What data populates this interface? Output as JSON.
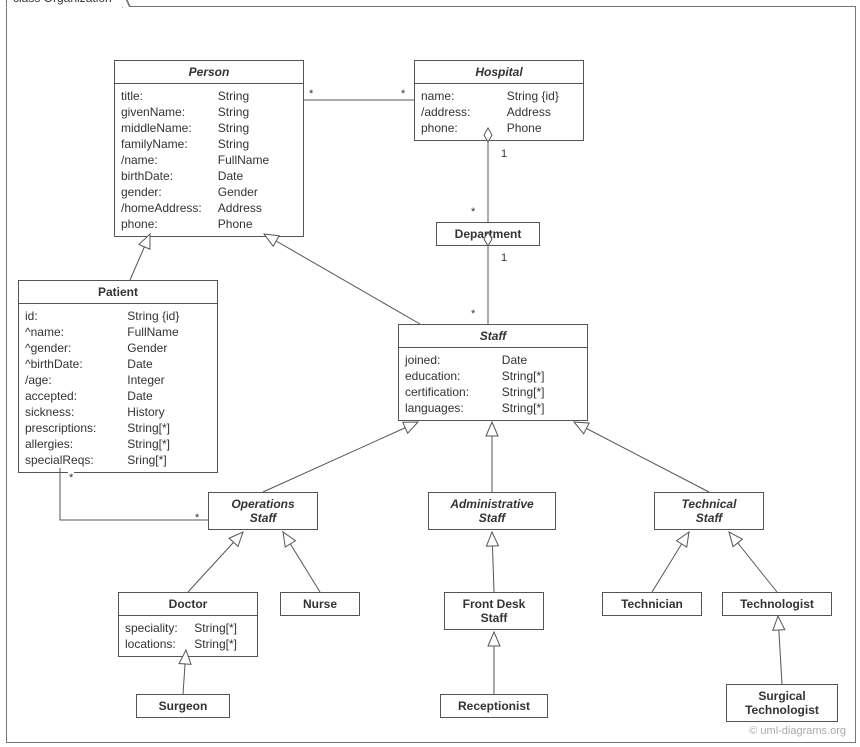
{
  "package_name": "class Organization",
  "watermark": "© uml-diagrams.org",
  "classes": {
    "person": {
      "name": "Person",
      "attrs": [
        {
          "n": "title:",
          "t": "String"
        },
        {
          "n": "givenName:",
          "t": "String"
        },
        {
          "n": "middleName:",
          "t": "String"
        },
        {
          "n": "familyName:",
          "t": "String"
        },
        {
          "n": "/name:",
          "t": "FullName"
        },
        {
          "n": "birthDate:",
          "t": "Date"
        },
        {
          "n": "gender:",
          "t": "Gender"
        },
        {
          "n": "/homeAddress:",
          "t": "Address"
        },
        {
          "n": "phone:",
          "t": "Phone"
        }
      ]
    },
    "hospital": {
      "name": "Hospital",
      "attrs": [
        {
          "n": "name:",
          "t": "String {id}"
        },
        {
          "n": "/address:",
          "t": "Address"
        },
        {
          "n": "phone:",
          "t": "Phone"
        }
      ]
    },
    "department": {
      "name": "Department"
    },
    "patient": {
      "name": "Patient",
      "attrs": [
        {
          "n": "id:",
          "t": "String {id}"
        },
        {
          "n": "^name:",
          "t": "FullName"
        },
        {
          "n": "^gender:",
          "t": "Gender"
        },
        {
          "n": "^birthDate:",
          "t": "Date"
        },
        {
          "n": "/age:",
          "t": "Integer"
        },
        {
          "n": "accepted:",
          "t": "Date"
        },
        {
          "n": "sickness:",
          "t": "History"
        },
        {
          "n": "prescriptions:",
          "t": "String[*]"
        },
        {
          "n": "allergies:",
          "t": "String[*]"
        },
        {
          "n": "specialReqs:",
          "t": "Sring[*]"
        }
      ]
    },
    "staff": {
      "name": "Staff",
      "attrs": [
        {
          "n": "joined:",
          "t": "Date"
        },
        {
          "n": "education:",
          "t": "String[*]"
        },
        {
          "n": "certification:",
          "t": "String[*]"
        },
        {
          "n": "languages:",
          "t": "String[*]"
        }
      ]
    },
    "opstaff": {
      "name": "Operations",
      "line2": "Staff"
    },
    "adminstaff": {
      "name": "Administrative",
      "line2": "Staff"
    },
    "techstaff": {
      "name": "Technical",
      "line2": "Staff"
    },
    "doctor": {
      "name": "Doctor",
      "attrs": [
        {
          "n": "speciality:",
          "t": "String[*]"
        },
        {
          "n": "locations:",
          "t": "String[*]"
        }
      ]
    },
    "nurse": {
      "name": "Nurse"
    },
    "frontdesk": {
      "name": "Front Desk",
      "line2": "Staff"
    },
    "technician": {
      "name": "Technician"
    },
    "technologist": {
      "name": "Technologist"
    },
    "surgeon": {
      "name": "Surgeon"
    },
    "receptionist": {
      "name": "Receptionist"
    },
    "surgtech": {
      "name": "Surgical",
      "line2": "Technologist"
    }
  },
  "mult": {
    "person_hospital_left": "*",
    "person_hospital_right": "*",
    "hospital_dept_right": "1",
    "hospital_dept_left": "*",
    "dept_staff_right": "1",
    "dept_staff_left": "*",
    "patient_ops_top": "*",
    "patient_ops_bottom": "*"
  }
}
